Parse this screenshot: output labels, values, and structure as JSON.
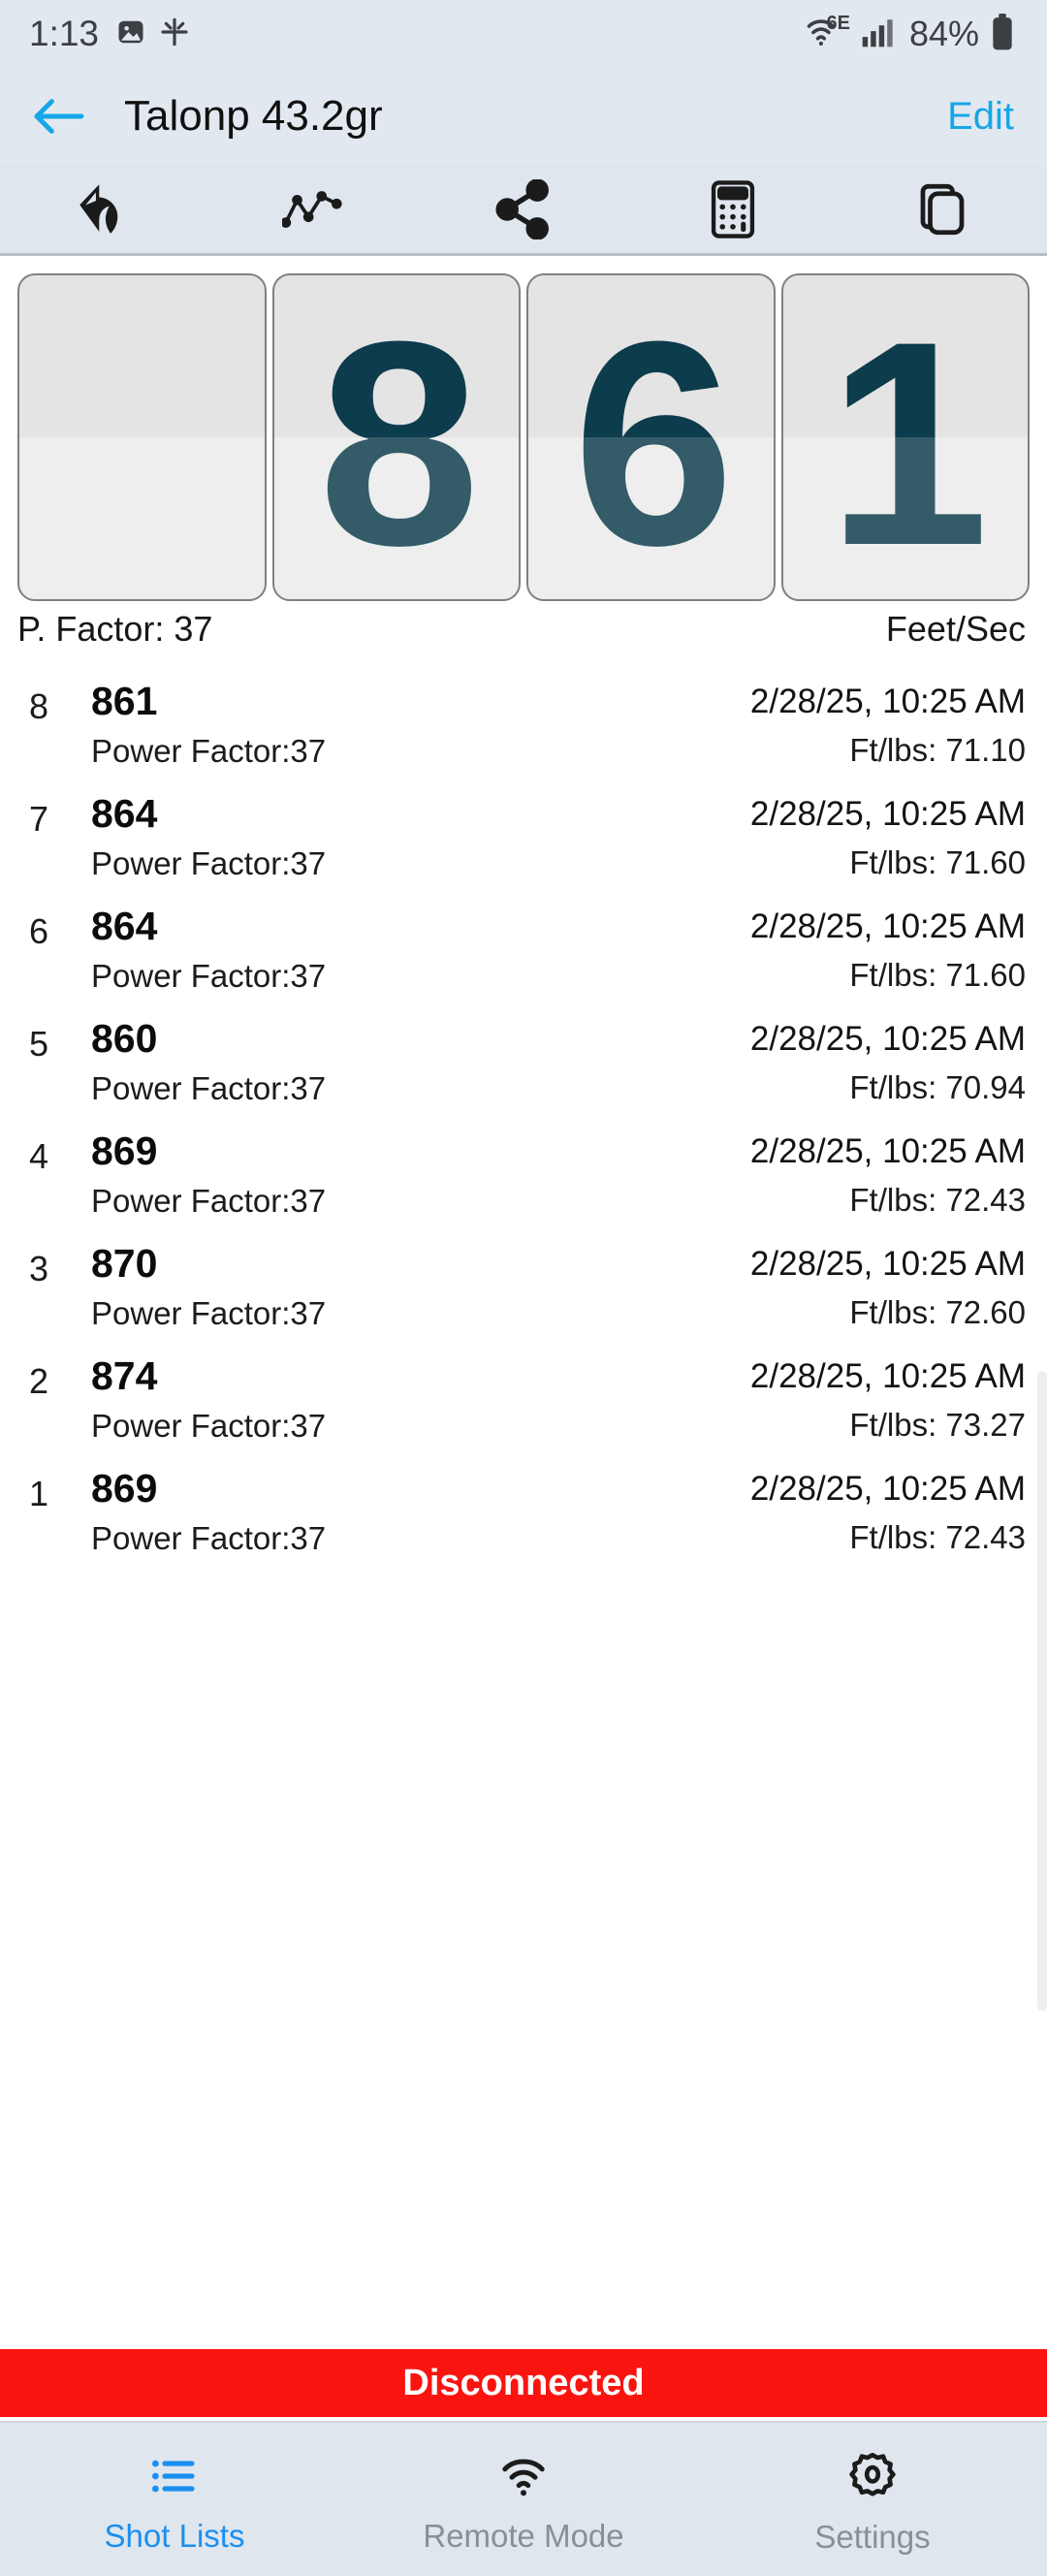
{
  "status_bar": {
    "time": "1:13",
    "left_icons": [
      "image-icon",
      "sparkle-icon"
    ],
    "wifi_label": "6E",
    "battery_percent": "84%",
    "right_icons": [
      "wifi-6e-icon",
      "cellular-signal-icon",
      "battery-icon"
    ]
  },
  "nav": {
    "back_icon": "arrow-left-icon",
    "title": "Talonp 43.2gr",
    "edit_label": "Edit",
    "accent_color": "#16a6e8"
  },
  "toolbar": {
    "buttons": [
      {
        "name": "undo-button",
        "icon": "undo-arrow-icon"
      },
      {
        "name": "graph-button",
        "icon": "line-chart-icon"
      },
      {
        "name": "share-button",
        "icon": "share-icon"
      },
      {
        "name": "calculator-button",
        "icon": "calculator-icon"
      },
      {
        "name": "duplicate-button",
        "icon": "copy-icon"
      }
    ]
  },
  "display": {
    "digits": [
      "",
      "8",
      "6",
      "1"
    ],
    "digit_color": "#0d3c4c",
    "power_factor_label": "P. Factor: 37",
    "units_label": "Feet/Sec"
  },
  "shots": {
    "rows": [
      {
        "index": "8",
        "velocity": "861",
        "power_factor": "Power Factor:37",
        "timestamp": "2/28/25, 10:25 AM",
        "energy": "Ft/lbs: 71.10"
      },
      {
        "index": "7",
        "velocity": "864",
        "power_factor": "Power Factor:37",
        "timestamp": "2/28/25, 10:25 AM",
        "energy": "Ft/lbs: 71.60"
      },
      {
        "index": "6",
        "velocity": "864",
        "power_factor": "Power Factor:37",
        "timestamp": "2/28/25, 10:25 AM",
        "energy": "Ft/lbs: 71.60"
      },
      {
        "index": "5",
        "velocity": "860",
        "power_factor": "Power Factor:37",
        "timestamp": "2/28/25, 10:25 AM",
        "energy": "Ft/lbs: 70.94"
      },
      {
        "index": "4",
        "velocity": "869",
        "power_factor": "Power Factor:37",
        "timestamp": "2/28/25, 10:25 AM",
        "energy": "Ft/lbs: 72.43"
      },
      {
        "index": "3",
        "velocity": "870",
        "power_factor": "Power Factor:37",
        "timestamp": "2/28/25, 10:25 AM",
        "energy": "Ft/lbs: 72.60"
      },
      {
        "index": "2",
        "velocity": "874",
        "power_factor": "Power Factor:37",
        "timestamp": "2/28/25, 10:25 AM",
        "energy": "Ft/lbs: 73.27"
      },
      {
        "index": "1",
        "velocity": "869",
        "power_factor": "Power Factor:37",
        "timestamp": "2/28/25, 10:25 AM",
        "energy": "Ft/lbs: 72.43"
      }
    ]
  },
  "banner": {
    "text": "Disconnected",
    "color": "#fa1410"
  },
  "tabs": [
    {
      "name": "tab-shot-lists",
      "label": "Shot Lists",
      "icon": "list-icon",
      "active": true
    },
    {
      "name": "tab-remote-mode",
      "label": "Remote Mode",
      "icon": "wifi-icon",
      "active": false
    },
    {
      "name": "tab-settings",
      "label": "Settings",
      "icon": "gear-icon",
      "active": false
    }
  ]
}
